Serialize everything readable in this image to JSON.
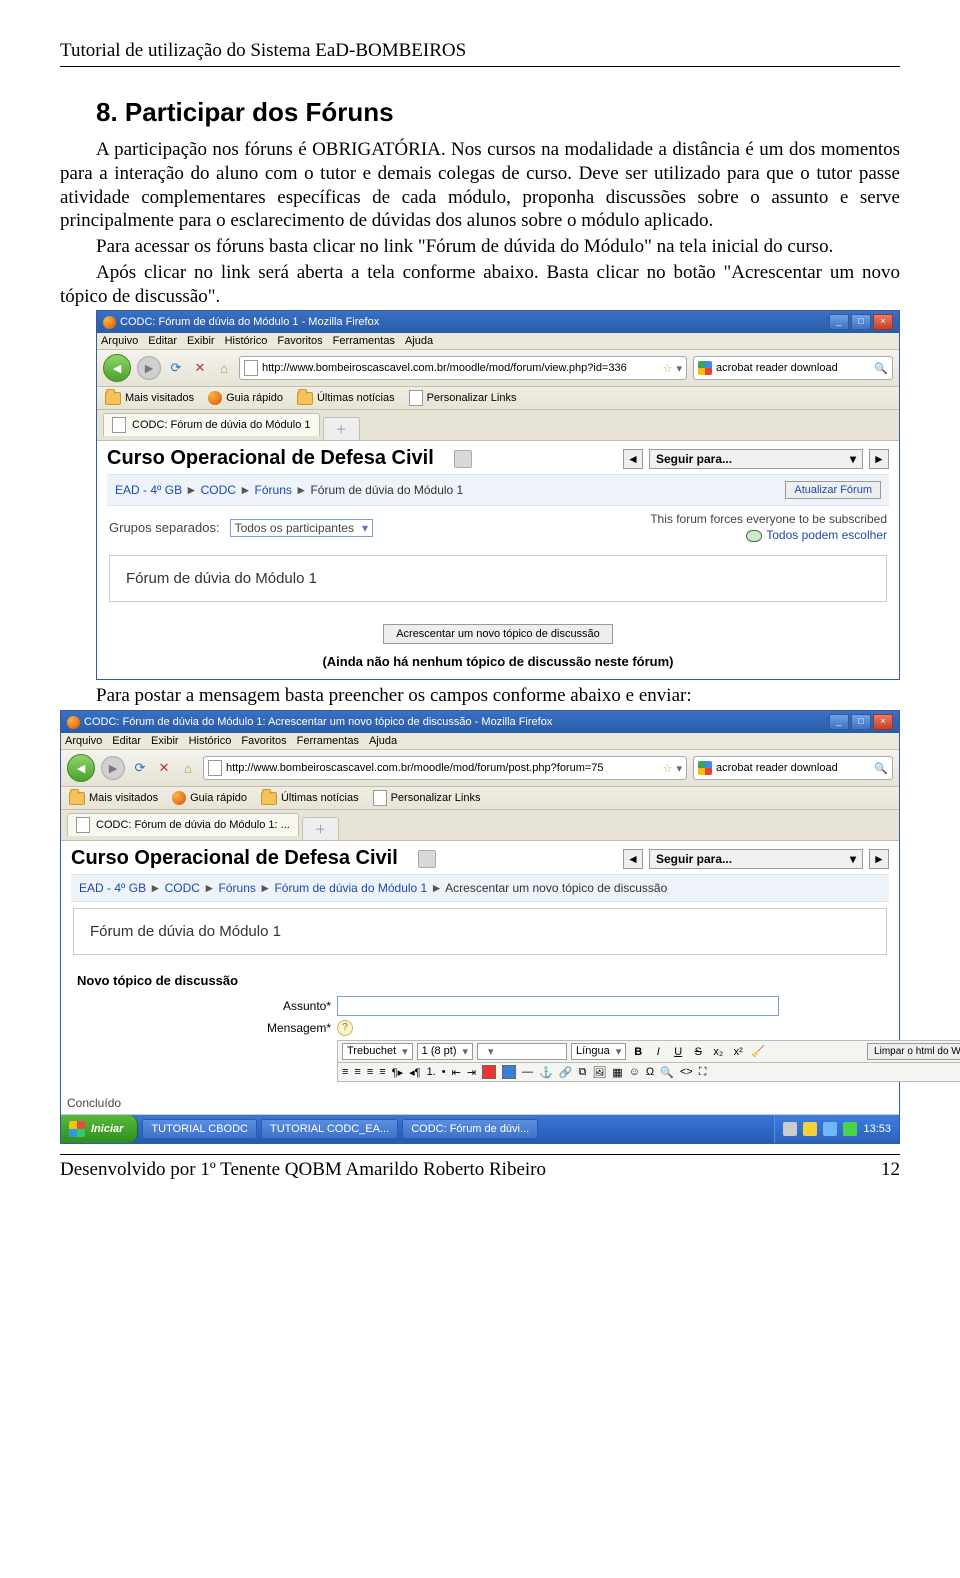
{
  "doc": {
    "header": "Tutorial de utilização do Sistema EaD-BOMBEIROS",
    "section_heading": "8. Participar dos Fóruns",
    "p1": "A participação nos fóruns é OBRIGATÓRIA. Nos cursos na modalidade a distância é um dos momentos para a interação do aluno com o tutor e demais colegas de curso. Deve ser utilizado para que o tutor passe atividade complementares específicas de cada módulo, proponha discussões sobre o assunto e serve principalmente para o esclarecimento de dúvidas dos alunos sobre o módulo aplicado.",
    "p2": "Para acessar os fóruns basta clicar no link \"Fórum de dúvida do Módulo\" na tela inicial do curso.",
    "p3": "Após clicar no link será aberta a tela conforme abaixo. Basta clicar no botão \"Acrescentar um novo tópico de discussão\".",
    "mid_caption": "Para postar a mensagem basta preencher os campos conforme abaixo e enviar:",
    "footer_left": "Desenvolvido por 1º Tenente QOBM Amarildo Roberto Ribeiro",
    "footer_right": "12"
  },
  "shot1": {
    "title": "CODC: Fórum de dúvia do Módulo 1 - Mozilla Firefox",
    "menu": [
      "Arquivo",
      "Editar",
      "Exibir",
      "Histórico",
      "Favoritos",
      "Ferramentas",
      "Ajuda"
    ],
    "url": "http://www.bombeiroscascavel.com.br/moodle/mod/forum/view.php?id=336",
    "search": "acrobat reader download",
    "bookmarks": [
      "Mais visitados",
      "Guia rápido",
      "Últimas notícias",
      "Personalizar Links"
    ],
    "tab": "CODC: Fórum de dúvia do Módulo 1",
    "course_title": "Curso Operacional de Defesa Civil",
    "jump_label": "Seguir para...",
    "breadcrumb": [
      "EAD - 4º GB",
      "CODC",
      "Fóruns",
      "Fórum de dúvia do Módulo 1"
    ],
    "update_btn": "Atualizar Fórum",
    "groups_label": "Grupos separados:",
    "groups_value": "Todos os participantes",
    "sub_note1": "This forum forces everyone to be subscribed",
    "sub_note2": "Todos podem escolher",
    "forum_name": "Fórum de dúvia do Módulo 1",
    "add_topic": "Acrescentar um novo tópico de discussão",
    "empty": "(Ainda não há nenhum tópico de discussão neste fórum)"
  },
  "shot2": {
    "title": "CODC: Fórum de dúvia do Módulo 1: Acrescentar um novo tópico de discussão - Mozilla Firefox",
    "menu": [
      "Arquivo",
      "Editar",
      "Exibir",
      "Histórico",
      "Favoritos",
      "Ferramentas",
      "Ajuda"
    ],
    "url": "http://www.bombeiroscascavel.com.br/moodle/mod/forum/post.php?forum=75",
    "search": "acrobat reader download",
    "bookmarks": [
      "Mais visitados",
      "Guia rápido",
      "Últimas notícias",
      "Personalizar Links"
    ],
    "tab": "CODC: Fórum de dúvia do Módulo 1: ...",
    "course_title": "Curso Operacional de Defesa Civil",
    "jump_label": "Seguir para...",
    "breadcrumb": [
      "EAD - 4º GB",
      "CODC",
      "Fóruns",
      "Fórum de dúvia do Módulo 1",
      "Acrescentar um novo tópico de discussão"
    ],
    "forum_name": "Fórum de dúvia do Módulo 1",
    "newtopic_heading": "Novo tópico de discussão",
    "field_subject": "Assunto*",
    "field_message": "Mensagem*",
    "editor_font": "Trebuchet",
    "editor_size": "1 (8 pt)",
    "editor_lang": "Língua",
    "word_btn": "Limpar o html do Word",
    "status_done": "Concluído",
    "taskbar": {
      "start": "Iniciar",
      "items": [
        "TUTORIAL CBODC",
        "TUTORIAL CODC_EA...",
        "CODC: Fórum de dúvi..."
      ],
      "time": "13:53"
    }
  }
}
